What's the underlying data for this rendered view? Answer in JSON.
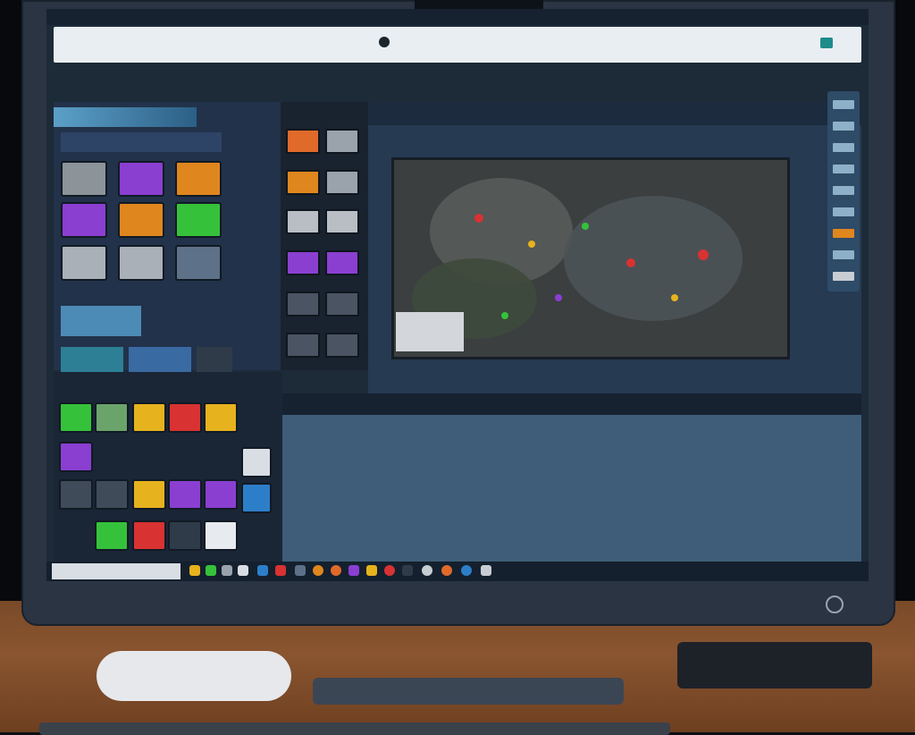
{
  "app": {
    "title": "",
    "top_right": ""
  },
  "addressbar": {
    "url": ""
  },
  "menu": [],
  "left_panel": {
    "title": ""
  },
  "panel2": {
    "title": ""
  },
  "viewer": {
    "controls": ""
  },
  "taskbar": {
    "clock": ""
  },
  "bezel": {
    "brand_left": "",
    "logo": ""
  },
  "colors": {
    "screen_bg": "#1d2a38",
    "accent": "#5ba0c8",
    "orange": "#e0861e",
    "purple": "#8a3fd1",
    "green": "#35c23a",
    "red": "#d83232",
    "yellow": "#e6b21e"
  },
  "icons": [
    "go-icon",
    "power-icon",
    "folder-icon",
    "star-icon",
    "chat-icon"
  ]
}
